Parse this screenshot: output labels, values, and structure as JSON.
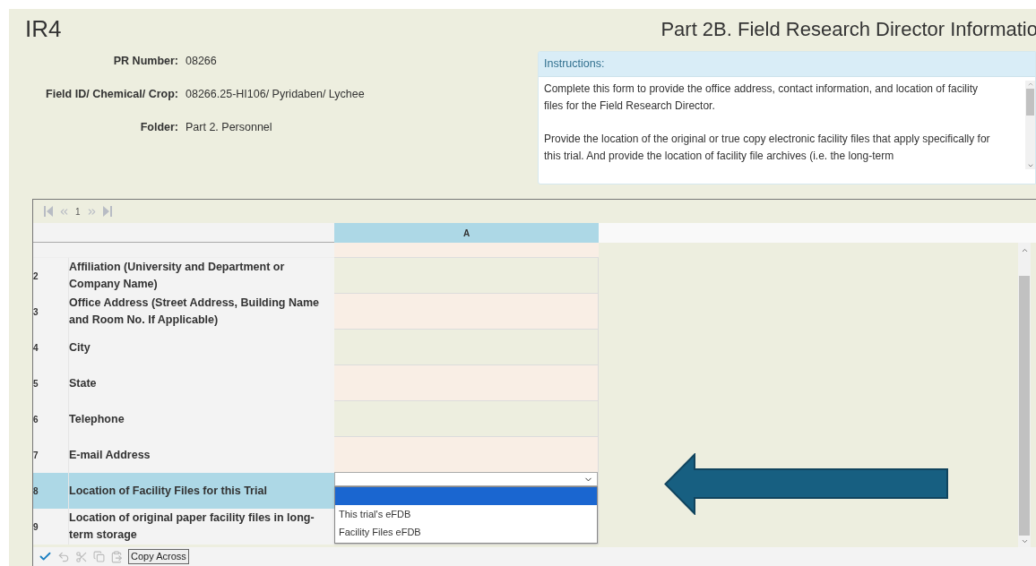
{
  "header": {
    "logo": "IR4",
    "title": "Part 2B. Field Research Director Informatio"
  },
  "info": [
    {
      "label": "PR Number:",
      "value": "08266"
    },
    {
      "label": "Field ID/ Chemical/ Crop:",
      "value": "08266.25-HI106/ Pyridaben/ Lychee"
    },
    {
      "label": "Folder:",
      "value": "Part 2. Personnel"
    }
  ],
  "instructions": {
    "heading": "Instructions:",
    "paragraphs": [
      "Complete this form to provide the office address, contact information, and location of facility files for the Field Research Director.",
      "Provide the location of the original or true copy electronic facility files that apply specifically for this trial. And provide the location of facility file archives (i.e. the long-term"
    ]
  },
  "pager": {
    "page": "1"
  },
  "grid": {
    "column": "A",
    "rows": [
      {
        "number": "2",
        "label": "Affiliation (University and Department or Company Name)",
        "selected": false
      },
      {
        "number": "3",
        "label": "Office Address (Street Address, Building Name and Room No. If Applicable)",
        "selected": false
      },
      {
        "number": "4",
        "label": "City",
        "selected": false
      },
      {
        "number": "5",
        "label": "State",
        "selected": false
      },
      {
        "number": "6",
        "label": "Telephone",
        "selected": false
      },
      {
        "number": "7",
        "label": "E-mail Address",
        "selected": false
      },
      {
        "number": "8",
        "label": "Location of Facility Files for this Trial",
        "selected": true
      },
      {
        "number": "9",
        "label": "Location of original paper facility files in long-term storage",
        "selected": false
      }
    ]
  },
  "dropdown": {
    "expanded": true,
    "options": [
      {
        "selected": true
      },
      {
        "label": "This trial's eFDB",
        "selected": false
      },
      {
        "label": "Facility Files eFDB",
        "selected": false
      }
    ]
  },
  "toolbar": {
    "copy_button": "Copy Across"
  }
}
